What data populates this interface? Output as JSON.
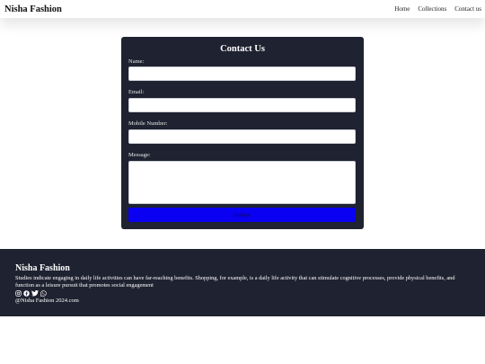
{
  "nav": {
    "brand": "Nisha Fashion",
    "links": [
      "Home",
      "Collections",
      "Contact us"
    ]
  },
  "form": {
    "title": "Contact Us",
    "name_label": "Name:",
    "email_label": "Email:",
    "mobile_label": "Mobile Number:",
    "message_label": "Message:",
    "name_value": "",
    "email_value": "",
    "mobile_value": "",
    "message_value": "",
    "submit_label": "Submit"
  },
  "footer": {
    "brand": "Nisha Fashion",
    "description": "Studies indicate engaging in daily life activities can have far-reaching benefits. Shopping, for example, is a daily life activity that can stimulate cognitive processes, provide physical benefits, and function as a leisure pursuit that promotes social engagement",
    "social_icons": [
      "instagram-icon",
      "facebook-icon",
      "twitter-icon",
      "whatsapp-icon"
    ],
    "copyright": "@Nisha Fashion 2024.com"
  },
  "colors": {
    "dark_panel": "#1f2230",
    "submit_blue": "#0a00f2",
    "page_bg": "#ffffff"
  }
}
